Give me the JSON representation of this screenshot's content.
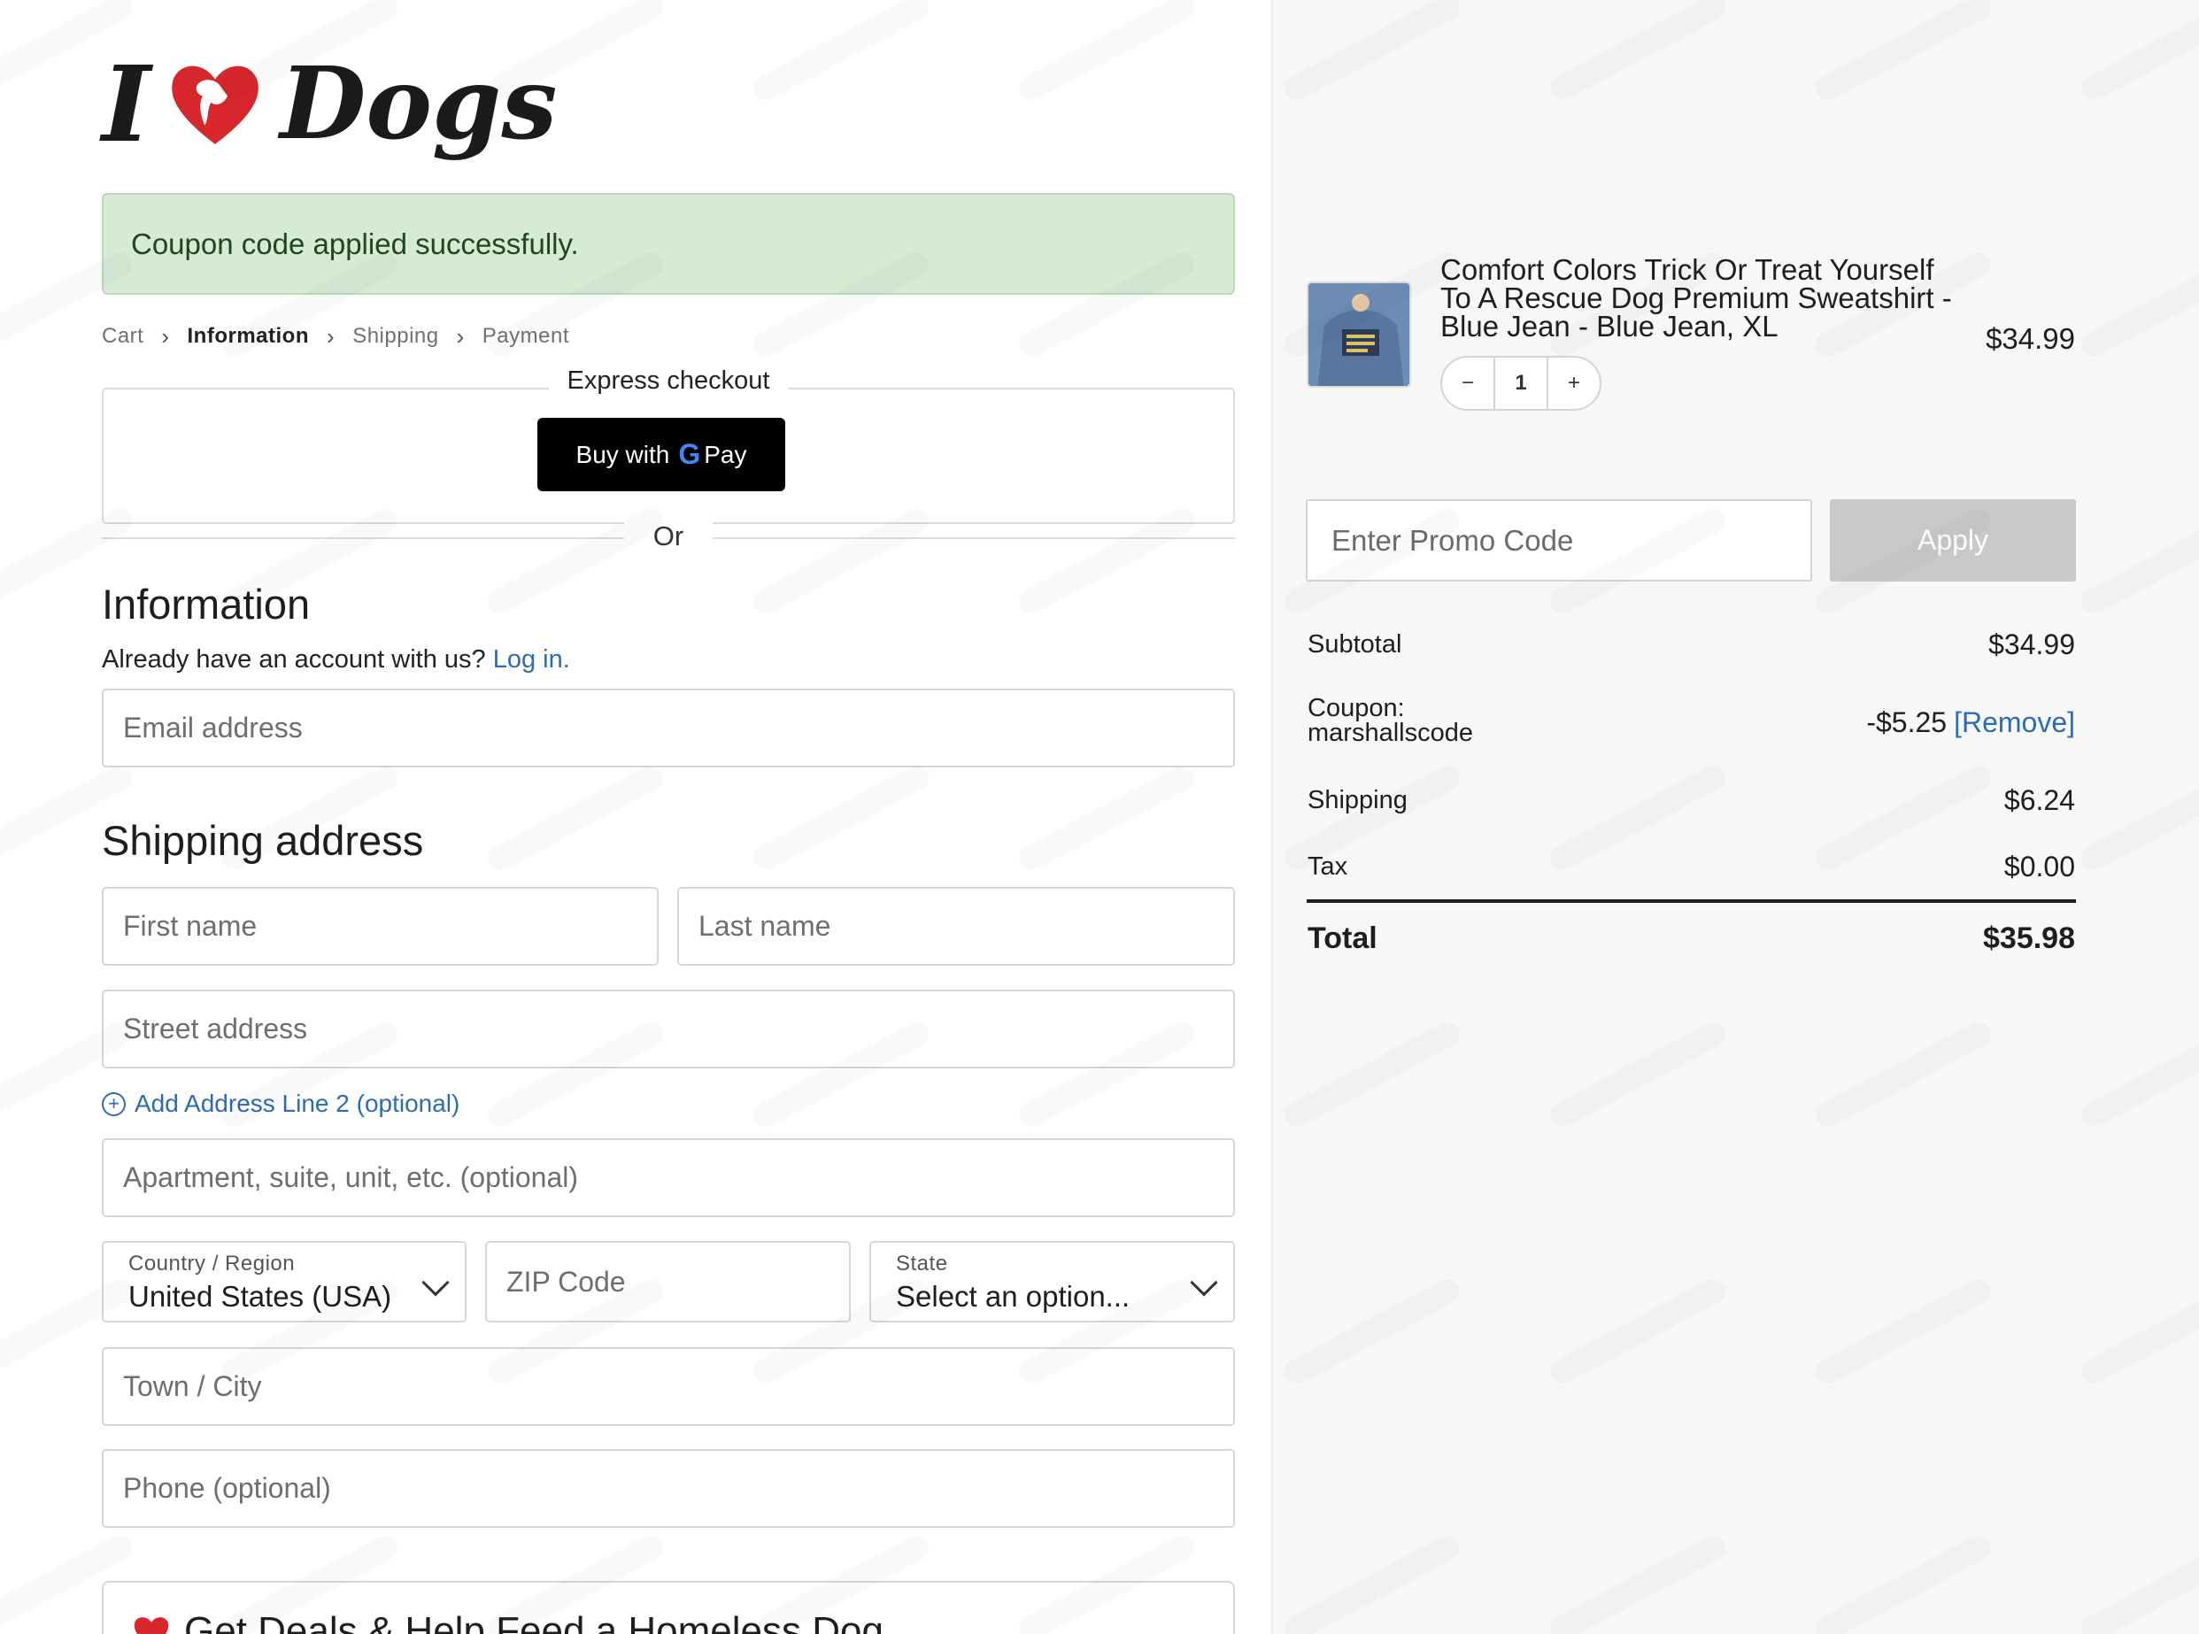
{
  "brand": {
    "logo_prefix": "I",
    "logo_suffix": "Dogs"
  },
  "notice": {
    "text": "Coupon code applied successfully."
  },
  "breadcrumb": {
    "items": [
      "Cart",
      "Information",
      "Shipping",
      "Payment"
    ],
    "active": "Information",
    "separator": "›"
  },
  "express": {
    "title": "Express checkout",
    "gpay_prefix": "Buy with",
    "gpay_g": "G",
    "gpay_suffix": "Pay",
    "or_label": "Or"
  },
  "information": {
    "heading": "Information",
    "account_prompt": "Already have an account with us?",
    "login_link": "Log in.",
    "email_placeholder": "Email address"
  },
  "shipping": {
    "heading": "Shipping address",
    "first_name": "First name",
    "last_name": "Last name",
    "street": "Street address",
    "add_line_label": "Add Address Line 2 (optional)",
    "apartment": "Apartment, suite, unit, etc. (optional)",
    "country_label": "Country / Region",
    "country_value": "United States (USA)",
    "zip": "ZIP Code",
    "state_label": "State",
    "state_value": "Select an option...",
    "city": "Town / City",
    "phone": "Phone (optional)"
  },
  "promo_banner": {
    "text": "Get Deals & Help Feed a Homeless Dog"
  },
  "order": {
    "product_title": "Comfort Colors Trick Or Treat Yourself To A Rescue Dog Premium Sweatshirt - Blue Jean - Blue Jean, XL",
    "price": "$34.99",
    "quantity": "1",
    "qty_minus": "−",
    "qty_plus": "+",
    "promo_placeholder": "Enter Promo Code",
    "apply_label": "Apply",
    "subtotal_label": "Subtotal",
    "subtotal_value": "$34.99",
    "coupon_label": "Coupon:",
    "coupon_code": "marshallscode",
    "coupon_value": "-$5.25",
    "coupon_remove": "[Remove]",
    "shipping_label": "Shipping",
    "shipping_value": "$6.24",
    "tax_label": "Tax",
    "tax_value": "$0.00",
    "total_label": "Total",
    "total_value": "$35.98"
  },
  "colors": {
    "accent_link": "#2d6cb0",
    "success_bg": "#d6ead4",
    "heart_red": "#d7262c",
    "apply_disabled": "#c9c9c9"
  },
  "icons": [
    "heart-logo-icon",
    "chevron-right-icon",
    "plus-circle-icon",
    "chevron-down-icon",
    "google-g-icon",
    "heart-icon"
  ]
}
